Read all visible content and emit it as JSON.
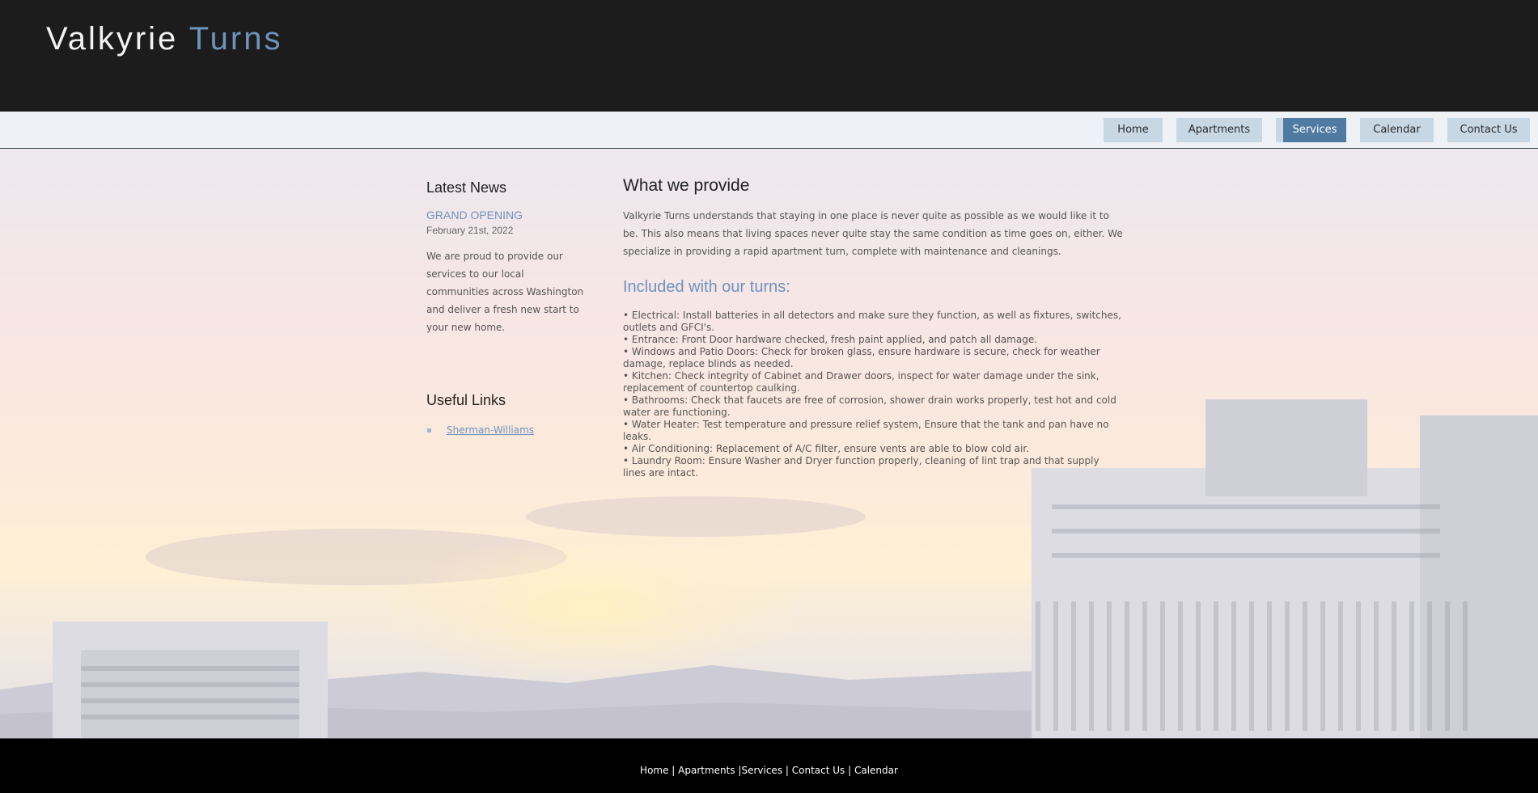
{
  "header": {
    "logo_part1": "Valkyrie",
    "logo_part2": "Turns"
  },
  "nav": {
    "items": [
      {
        "label": "Home",
        "active": false
      },
      {
        "label": "Apartments",
        "active": false
      },
      {
        "label": "Services",
        "active": true
      },
      {
        "label": "Calendar",
        "active": false
      },
      {
        "label": "Contact Us",
        "active": false
      }
    ]
  },
  "sidebar": {
    "latest_news_heading": "Latest News",
    "news_title": "GRAND OPENING",
    "news_date": "February 21st, 2022",
    "news_body": "We are proud to provide our services to our local communities across Washington and deliver a fresh new start to your new home.",
    "useful_links_heading": "Useful Links",
    "links": [
      "Sherman-Williams"
    ]
  },
  "main": {
    "heading": "What we provide",
    "intro": "Valkyrie Turns understands that staying in one place is never quite as possible as we would like it to be. This also means that living spaces never quite stay the same condition as time goes on, either. We specialize in providing a rapid apartment turn, complete with maintenance and cleanings.",
    "included_heading": "Included with our turns:",
    "items": [
      "• Electrical: Install batteries in all detectors and make sure they function, as well as fixtures, switches, outlets and GFCI's.",
      "• Entrance: Front Door hardware checked, fresh paint applied, and patch all damage.",
      "• Windows and Patio Doors: Check for broken glass, ensure hardware is secure, check for weather damage, replace blinds as needed.",
      "• Kitchen: Check integrity of Cabinet and Drawer doors, inspect for water damage under the sink, replacement of countertop caulking.",
      "• Bathrooms: Check that faucets are free of corrosion, shower drain works properly, test hot and cold water are functioning.",
      "• Water Heater: Test temperature and pressure relief system, Ensure that the tank and pan have no leaks.",
      "• Air Conditioning: Replacement of A/C filter, ensure vents are able to blow cold air.",
      "• Laundry Room: Ensure Washer and Dryer function properly, cleaning of lint trap and that supply lines are intact."
    ]
  },
  "footer": {
    "home": "Home",
    "apartments": "Apartments",
    "services": "Services",
    "contact": "Contact Us",
    "calendar": "Calendar",
    "sep1": " | ",
    "sep2": " |",
    "sep3": " | ",
    "sep4": " | "
  },
  "colors": {
    "header_bg": "#1c1c1c",
    "accent": "#6f93bd",
    "nav_button": "#c7d7e4",
    "nav_active": "#4f7aa2",
    "footer_bg": "#000000"
  }
}
